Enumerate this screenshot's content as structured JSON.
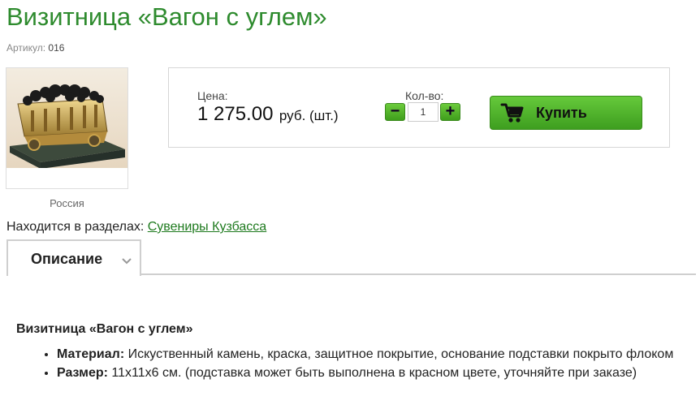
{
  "product": {
    "title": "Визитница «Вагон с углем»",
    "sku_label": "Артикул:",
    "sku_value": "016",
    "country": "Россия"
  },
  "buybox": {
    "price_label": "Цена:",
    "price_amount": "1 275.00",
    "price_currency": "руб. (шт.)",
    "qty_label": "Кол-во:",
    "qty_value": "1",
    "minus_label": "−",
    "plus_label": "+",
    "buy_label": "Купить",
    "buy_icon": "cart-icon",
    "accent_color": "#4caf2a"
  },
  "sections": {
    "label": "Находится в разделах:",
    "link": "Сувениры Кузбасса"
  },
  "tabs": [
    {
      "label": "Описание",
      "active": true
    }
  ],
  "description": {
    "title": "Визитница «Вагон с углем»",
    "items": [
      {
        "key": "Материал:",
        "text": "Искуственный камень, краска, защитное покрытие, основание подставки покрыто флоком"
      },
      {
        "key": "Размер:",
        "text": "11x11x6 см. (подставка может быть выполнена в красном цвете, уточняйте при заказе)"
      }
    ]
  },
  "colors": {
    "title_green": "#2e8b2e",
    "link_green": "#1e7a1e"
  }
}
